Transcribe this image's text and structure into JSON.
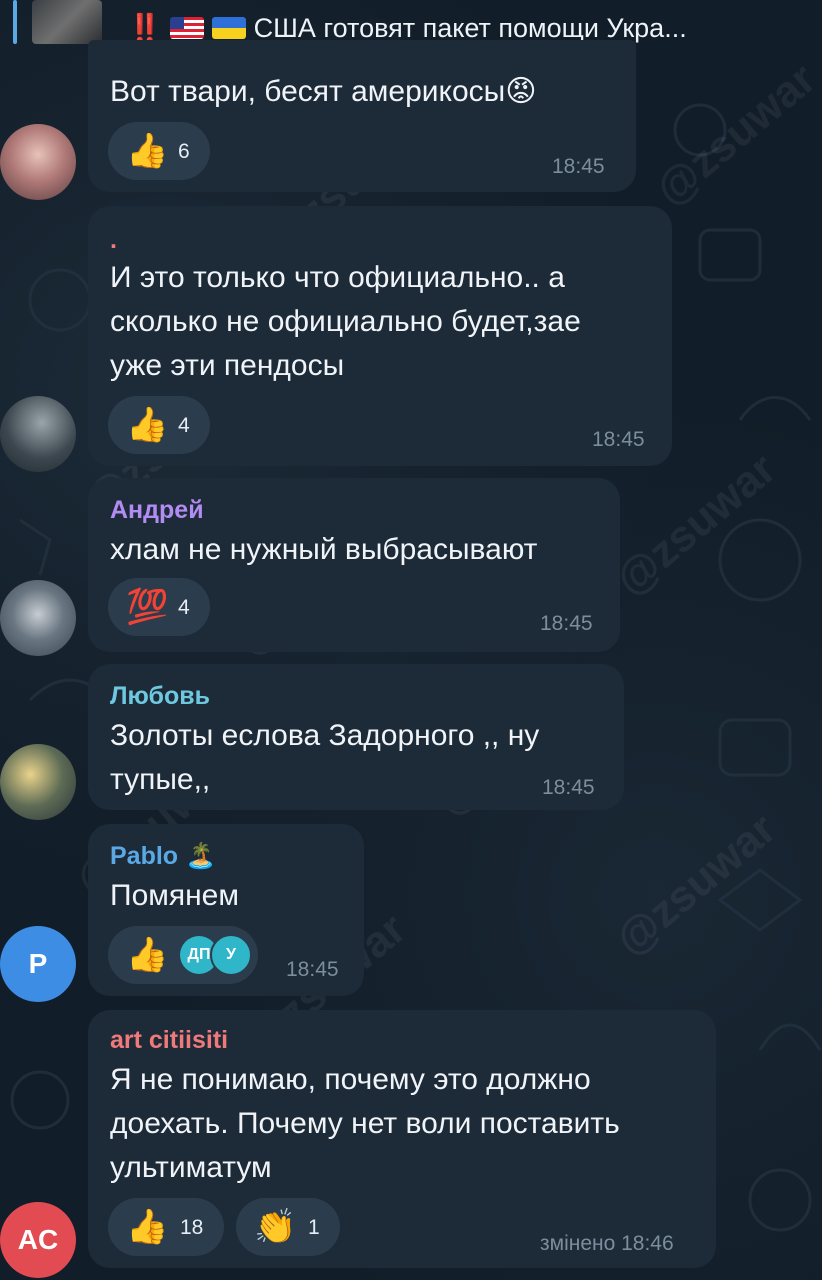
{
  "reply": {
    "marks": "‼️",
    "text": "США готовят пакет помощи Укра..."
  },
  "watermark": "@zsuwar",
  "messages": [
    {
      "sender": "",
      "text": "Вот твари, бесят америкосы😡",
      "reactions": [
        {
          "emoji": "👍",
          "count": "6"
        }
      ],
      "time": "18:45"
    },
    {
      "sender": ".",
      "text": "И это только что официально..  а\nсколько не официально будет,зае\nуже эти пендосы",
      "reactions": [
        {
          "emoji": "👍",
          "count": "4"
        }
      ],
      "time": "18:45"
    },
    {
      "sender": "Андрей",
      "sender_color": "#b28cf2",
      "text": "хлам не нужный выбрасывают",
      "reactions": [
        {
          "emoji": "💯",
          "count": "4"
        }
      ],
      "time": "18:45"
    },
    {
      "sender": "Любовь",
      "sender_color": "#6ec9e0",
      "text": "Золоты еслова Задорного ,, ну\nтупые,,",
      "reactions": [],
      "time": "18:45"
    },
    {
      "sender": "Pablo",
      "sender_emoji": "🏝️",
      "sender_color": "#5aa9e6",
      "text": "Помянем",
      "reactions": [
        {
          "emoji": "👍",
          "reactors": [
            "ДП",
            "У"
          ]
        }
      ],
      "time": "18:45",
      "avatar_letter": "P"
    },
    {
      "sender": "art citiisiti",
      "sender_color": "#f07a7a",
      "text": "Я не понимаю, почему это должно\nдоехать. Почему нет воли поставить\nультиматум",
      "reactions": [
        {
          "emoji": "👍",
          "count": "18"
        },
        {
          "emoji": "👏",
          "count": "1"
        }
      ],
      "time": "змінено 18:46",
      "avatar_letter": "AC"
    }
  ],
  "colors": {
    "bubble": "#1d2a37",
    "reaction_pill": "#2b3c4c",
    "pablo_avatar": "#3d8de5",
    "art_avatar": "#e24b52"
  }
}
